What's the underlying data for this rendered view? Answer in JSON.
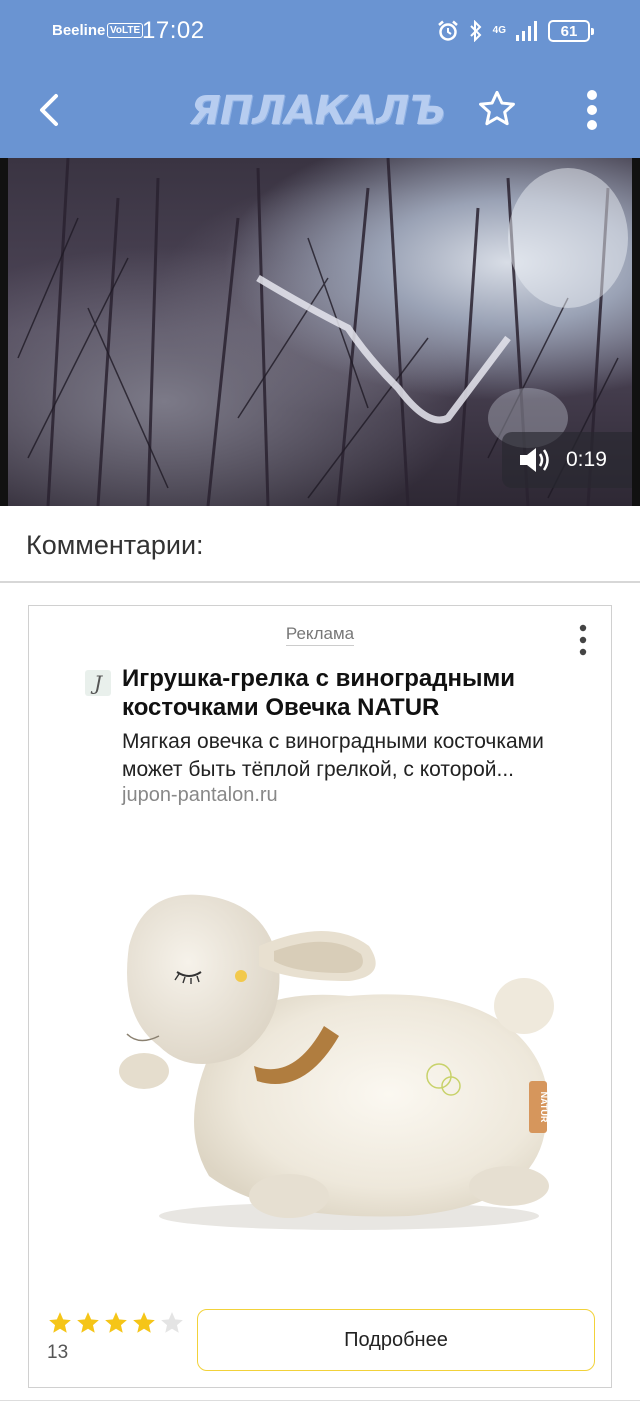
{
  "status_bar": {
    "carrier": "Beeline",
    "volte": "VoLTE",
    "time": "17:02",
    "network": "4G",
    "battery": "61"
  },
  "app_bar": {
    "logo": "ЯПЛАКАЛЪ",
    "accent_color": "#6a94d2"
  },
  "video": {
    "duration": "0:19"
  },
  "comments": {
    "title": "Комментарии:"
  },
  "ad": {
    "label": "Реклама",
    "favicon_letter": "J",
    "title": "Игрушка-грелка с виноградными косточками Овечка NATUR",
    "description": "Мягкая овечка с виноградными косточками может быть тёплой грелкой, с которой...",
    "domain": "jupon-pantalon.ru",
    "rating": 4,
    "rating_max": 5,
    "rating_count": "13",
    "button_label": "Подробнее",
    "toy_tag": "NATUR"
  }
}
